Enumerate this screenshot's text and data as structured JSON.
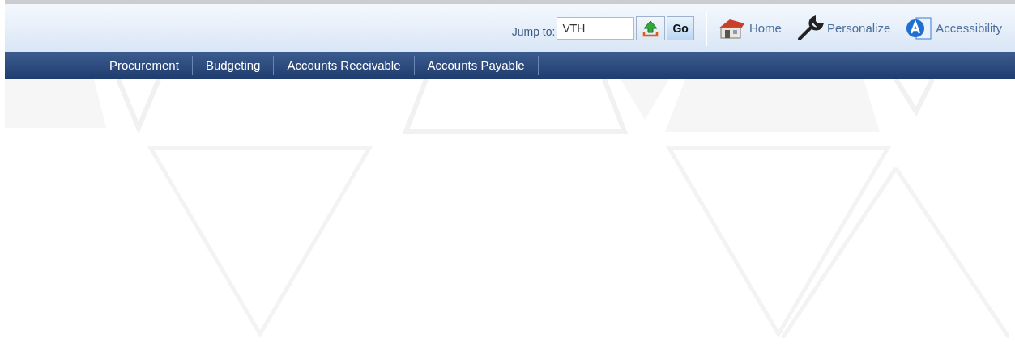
{
  "header": {
    "jump_label": "Jump to:",
    "jump_field": {
      "value": "VTH"
    },
    "go_button": "Go",
    "links": [
      {
        "kind": "home",
        "label": "Home"
      },
      {
        "kind": "personalize",
        "label": "Personalize"
      },
      {
        "kind": "accessibility",
        "label": "Accessibility"
      }
    ]
  },
  "nav": {
    "items": [
      {
        "label": "Procurement"
      },
      {
        "label": "Budgeting"
      },
      {
        "label": "Accounts Receivable"
      },
      {
        "label": "Accounts Payable"
      }
    ]
  }
}
